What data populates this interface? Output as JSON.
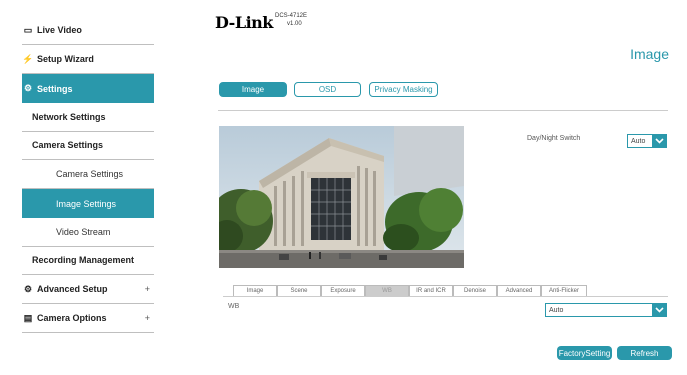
{
  "sidebar": {
    "live_video": "Live Video",
    "setup_wizard": "Setup Wizard",
    "settings": "Settings",
    "network_settings": "Network Settings",
    "camera_settings": "Camera Settings",
    "camera_settings_sub": "Camera Settings",
    "image_settings": "Image Settings",
    "video_stream": "Video Stream",
    "recording_management": "Recording Management",
    "advanced_setup": "Advanced Setup",
    "camera_options": "Camera Options",
    "plus": "+"
  },
  "header": {
    "brand": "D-Link",
    "model": "DCS-4712E",
    "version": "v1.00",
    "page_title": "Image"
  },
  "tabs": [
    "Image",
    "OSD",
    "Privacy Masking"
  ],
  "day_night": {
    "label": "Day/Night Switch",
    "value": "Auto"
  },
  "sub_tabs": [
    "Image",
    "Scene",
    "Exposure",
    "WB",
    "IR and ICR",
    "Denoise",
    "Advanced",
    "Anti-Flicker"
  ],
  "wb": {
    "label": "WB",
    "value": "Auto"
  },
  "buttons": {
    "factory": "FactorySetting",
    "refresh": "Refresh"
  },
  "colors": {
    "accent": "#2a98ab"
  }
}
